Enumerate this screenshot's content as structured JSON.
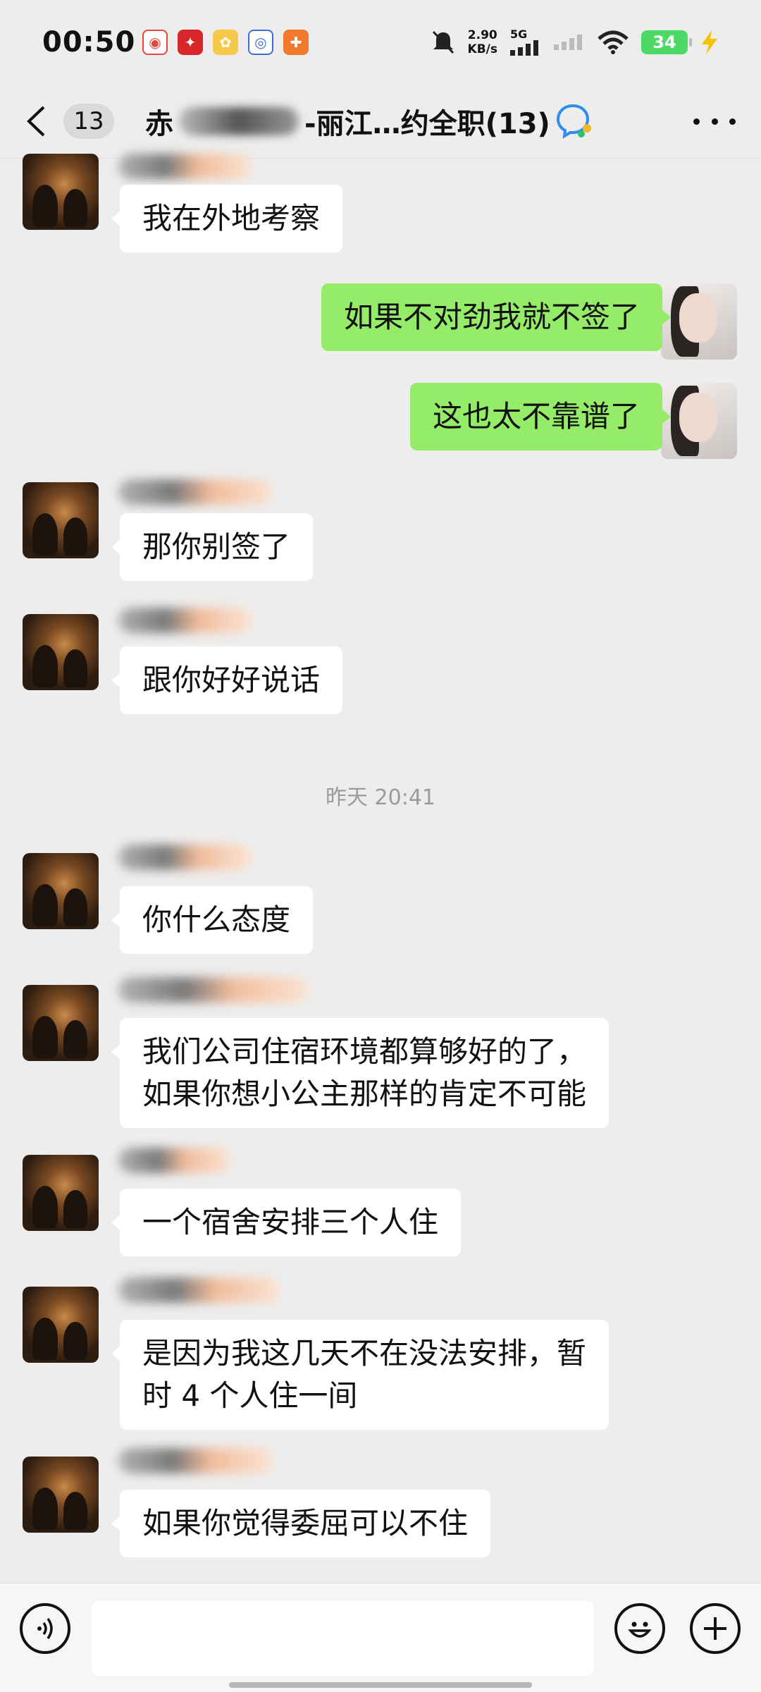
{
  "status_bar": {
    "time": "00:50",
    "net_speed_value": "2.90",
    "net_speed_unit": "KB/s",
    "network": "5G",
    "battery": "34",
    "notification_icons": [
      "weibo-icon",
      "app-red-icon",
      "app-flower-icon",
      "app-blue-icon",
      "app-orange-icon"
    ]
  },
  "header": {
    "unread_count": "13",
    "title_prefix": "赤",
    "title_suffix": "-丽江…约全职(13)"
  },
  "messages": [
    {
      "side": "left",
      "text": "我在外地考察"
    },
    {
      "side": "right",
      "text": "如果不对劲我就不签了"
    },
    {
      "side": "right",
      "text": "这也太不靠谱了"
    },
    {
      "side": "left",
      "text": "那你别签了"
    },
    {
      "side": "left",
      "text": "跟你好好说话"
    },
    {
      "side": "left",
      "text": "你什么态度"
    },
    {
      "side": "left",
      "line1": "我们公司住宿环境都算够好的了，",
      "line2": "如果你想小公主那样的肯定不可能"
    },
    {
      "side": "left",
      "text": "一个宿舍安排三个人住"
    },
    {
      "side": "left",
      "line1": "是因为我这几天不在没法安排，暂",
      "line2": "时 4 个人住一间"
    },
    {
      "side": "left",
      "text": "如果你觉得委屈可以不住"
    }
  ],
  "timestamp": "昨天 20:41",
  "colors": {
    "background": "#ededed",
    "my_bubble": "#95ec69",
    "their_bubble": "#ffffff",
    "battery": "#4cd964"
  }
}
